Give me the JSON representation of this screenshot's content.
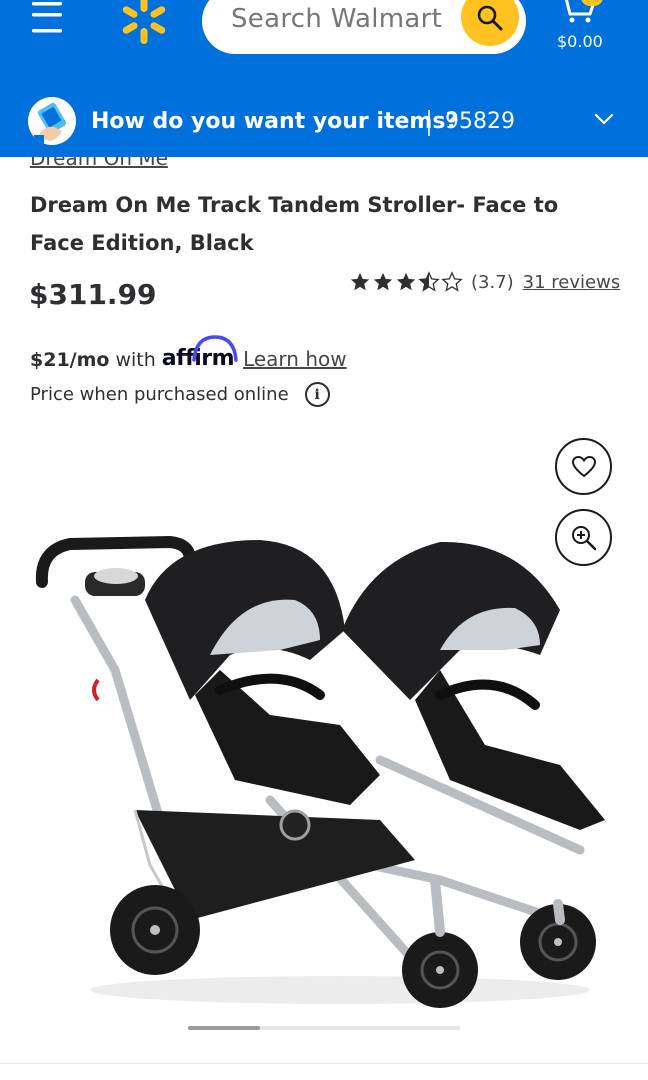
{
  "header": {
    "search": {
      "placeholder": "Search Walmart"
    },
    "cart": {
      "total": "$0.00"
    },
    "fulfillment": {
      "prompt": "How do you want your items?",
      "zip": "95829"
    }
  },
  "product": {
    "brand": "Dream On Me",
    "title": "Dream On Me Track Tandem Stroller- Face to Face Edition, Black",
    "price": "$311.99",
    "rating": {
      "value": "(3.7)",
      "stars": 3.5,
      "reviews": "31 reviews"
    },
    "affirm": {
      "monthly": "$21/mo",
      "with": "with",
      "brand": "affirm",
      "learn": "Learn how"
    },
    "price_note": "Price when purchased online",
    "info_glyph": "i"
  },
  "colors": {
    "header_blue": "#0071dc",
    "spark_yellow": "#ffc220",
    "text": "#2e2f32"
  },
  "icons": [
    "menu-icon",
    "spark-logo-icon",
    "search-icon",
    "cart-icon",
    "fulfillment-icon",
    "chevron-down-icon",
    "star-icon",
    "info-icon",
    "heart-icon",
    "zoom-in-icon"
  ]
}
